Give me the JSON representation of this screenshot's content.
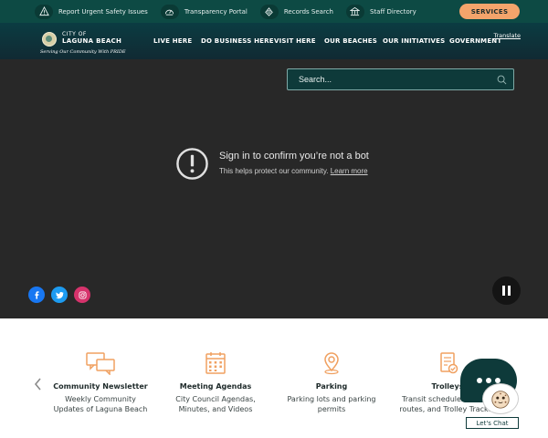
{
  "utility": {
    "items": [
      {
        "label": "Report Urgent Safety Issues",
        "icon": "warning-icon"
      },
      {
        "label": "Transparency Portal",
        "icon": "gauge-icon"
      },
      {
        "label": "Records Search",
        "icon": "document-icon"
      },
      {
        "label": "Staff Directory",
        "icon": "building-icon"
      }
    ],
    "services_label": "SERVICES"
  },
  "logo": {
    "city": "CITY OF",
    "name": "LAGUNA BEACH",
    "tagline": "Serving Our Community With PRIDE"
  },
  "nav": {
    "items": [
      "LIVE HERE",
      "DO BUSINESS HERE",
      "VISIT HERE",
      "OUR BEACHES",
      "OUR INITIATIVES",
      "GOVERNMENT"
    ],
    "translate": "Translate"
  },
  "search": {
    "placeholder": "Search..."
  },
  "video_notice": {
    "title": "Sign in to confirm you’re not a bot",
    "subtitle": "This helps protect our community.",
    "link": "Learn more"
  },
  "social": [
    "facebook-icon",
    "twitter-icon",
    "instagram-icon"
  ],
  "quick_links": [
    {
      "title": "Community Newsletter",
      "desc": "Weekly Community Updates of Laguna Beach",
      "icon": "chat-bubbles-icon"
    },
    {
      "title": "Meeting Agendas",
      "desc": "City Council Agendas, Minutes, and Videos",
      "icon": "calendar-icon"
    },
    {
      "title": "Parking",
      "desc": "Parking lots and parking permits",
      "icon": "location-pin-icon"
    },
    {
      "title": "Trolleys",
      "desc": "Transit schedules, Trolley routes, and Trolley Tracker",
      "icon": "clipboard-check-icon"
    }
  ],
  "chat": {
    "label": "Let's Chat"
  },
  "colors": {
    "topbar": "#0d4a44",
    "accent": "#f4a46b",
    "icon_orange": "#f0a060",
    "hero": "#282828"
  }
}
